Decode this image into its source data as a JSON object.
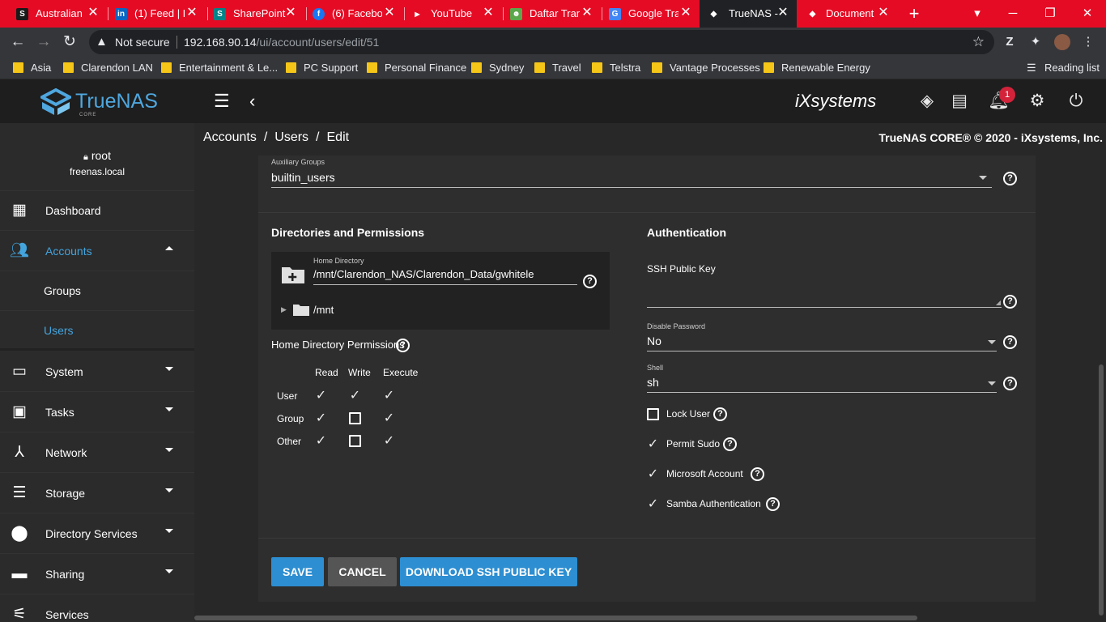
{
  "browser": {
    "tabs": [
      {
        "title": "Australian",
        "fav": "S",
        "favbg": "#1a1a1a"
      },
      {
        "title": "(1) Feed | L",
        "fav": "in",
        "favbg": "#0a66c2"
      },
      {
        "title": "SharePoint",
        "fav": "S",
        "favbg": "#038387"
      },
      {
        "title": "(6) Facebo",
        "fav": "f",
        "favbg": "#1877f2"
      },
      {
        "title": "YouTube",
        "fav": "▶",
        "favbg": "#e60b24"
      },
      {
        "title": "Daftar Tran",
        "fav": "☻",
        "favbg": "#5ca74b"
      },
      {
        "title": "Google Tra",
        "fav": "G",
        "favbg": "#4285f4"
      },
      {
        "title": "TrueNAS -",
        "fav": "◆",
        "favbg": "#202124"
      },
      {
        "title": "Document",
        "fav": "◆",
        "favbg": "#e60b24"
      }
    ],
    "not_secure": "Not secure",
    "url_host": "192.168.90.14",
    "url_path": "/ui/account/users/edit/51",
    "bookmarks": [
      "Asia",
      "Clarendon LAN",
      "Entertainment & Le...",
      "PC Support",
      "Personal Finance",
      "Sydney",
      "Travel",
      "Telstra",
      "Vantage Processes",
      "Renewable Energy"
    ],
    "reading_list": "Reading list"
  },
  "header": {
    "logo_text": "TrueNAS",
    "logo_sub": "CORE",
    "vendor": "iXsystems",
    "notification_count": "1"
  },
  "sidebar": {
    "user": "root",
    "host": "freenas.local",
    "items": [
      {
        "label": "Dashboard",
        "icon": "dashboard-icon"
      },
      {
        "label": "Accounts",
        "icon": "accounts-icon"
      },
      {
        "label": "Groups"
      },
      {
        "label": "Users"
      },
      {
        "label": "System",
        "icon": "system-icon"
      },
      {
        "label": "Tasks",
        "icon": "tasks-icon"
      },
      {
        "label": "Network",
        "icon": "network-icon"
      },
      {
        "label": "Storage",
        "icon": "storage-icon"
      },
      {
        "label": "Directory Services",
        "icon": "directory-icon"
      },
      {
        "label": "Sharing",
        "icon": "sharing-icon"
      },
      {
        "label": "Services",
        "icon": "services-icon"
      }
    ]
  },
  "breadcrumb": {
    "items": [
      "Accounts",
      "Users",
      "Edit"
    ],
    "copyright": "TrueNAS CORE® © 2020 - iXsystems, Inc."
  },
  "form": {
    "aux_groups_label": "Auxiliary Groups",
    "aux_groups_value": "builtin_users",
    "dirs_title": "Directories and Permissions",
    "home_dir_label": "Home Directory",
    "home_dir_value": "/mnt/Clarendon_NAS/Clarendon_Data/gwhitele",
    "tree_root": "/mnt",
    "perm_title": "Home Directory Permissions",
    "perm_cols": [
      "Read",
      "Write",
      "Execute"
    ],
    "perm_rows": [
      {
        "name": "User",
        "read": true,
        "write": true,
        "execute": true
      },
      {
        "name": "Group",
        "read": true,
        "write": false,
        "execute": true
      },
      {
        "name": "Other",
        "read": true,
        "write": false,
        "execute": true
      }
    ],
    "auth_title": "Authentication",
    "ssh_key_label": "SSH Public Key",
    "disable_password_label": "Disable Password",
    "disable_password_value": "No",
    "shell_label": "Shell",
    "shell_value": "sh",
    "lock_user_label": "Lock User",
    "lock_user": false,
    "permit_sudo_label": "Permit Sudo",
    "permit_sudo": true,
    "microsoft_account_label": "Microsoft Account",
    "microsoft_account": true,
    "samba_auth_label": "Samba Authentication",
    "samba_auth": true
  },
  "buttons": {
    "save": "SAVE",
    "cancel": "CANCEL",
    "download": "DOWNLOAD SSH PUBLIC KEY"
  }
}
